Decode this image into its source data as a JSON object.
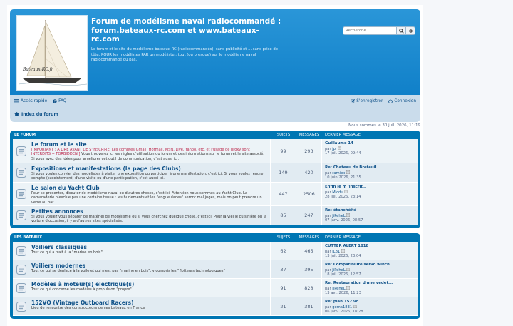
{
  "header": {
    "title": "Forum de modélisme naval radiocommandé : forum.bateaux-rc.com et www.bateaux-rc.com",
    "description": "Le forum et le site du modélisme bateaux RC (radiocommandés), sans publicité et ... sans prise de tête. POUR les modélistes PAR un modéliste : tout (ou presque) sur le modélisme naval radiocommandé ou pas.",
    "logo_text": "Bateaux-RC.fr",
    "search_placeholder": "Recherche…"
  },
  "nav": {
    "quick_access": "Accès rapide",
    "faq": "FAQ",
    "register": "S'enregistrer",
    "login": "Connexion",
    "breadcrumb": "Index du forum"
  },
  "datetime": "Nous sommes le 30 juil. 2026, 11:19",
  "columns": {
    "topics": "SUJETS",
    "messages": "MESSAGES",
    "last_post": "DERNIER MESSAGE"
  },
  "categories": [
    {
      "title": "LE FORUM",
      "forums": [
        {
          "name": "Le forum et le site",
          "warning": "[IMPORTANT : A LIRE AVANT DE S'INSCRIRE. Les comptes Gmail, Hotmail, MSN, Live, Yahoo, etc. et l'usage de proxy sont INTERDITS = FORBIDDEN ]",
          "desc": "Vous trouverez ici les règles d'utilisation du forum et des informations sur le forum et le site associé. Si vous avez des idées pour améliorer cet outil de communication, c'est aussi ici.",
          "topics": "99",
          "posts": "293",
          "last_title": "Guillaume 14",
          "last_by": "par",
          "last_author": "jpl",
          "last_date": "17 juil. 2026, 09:44"
        },
        {
          "name": "Expositions et manifestations (la page des Clubs)",
          "warning": "",
          "desc": "Si vous voulez convier des modélistes à visiter une exposition ou participer à une manifestation, c'est ici. Si vous voulez rendre compte (succintement) d'une visite ou d'une participation, c'est aussi ici.",
          "topics": "149",
          "posts": "420",
          "last_title": "Re: Chateau de Breteuil",
          "last_by": "par",
          "last_author": "ramiex",
          "last_date": "10 juin 2026, 21:35"
        },
        {
          "name": "Le salon du Yacht Club",
          "warning": "",
          "desc": "Pour se présenter, discuter de modélisme naval ou d'autres choses, c'est ici. Attention nous sommes au Yacht Club. La camaraderie n'exclue pas une certaine tenue : les hurlements et les \"engueulades\" seront mal jugés, mais on peut prendre un verre au bar.",
          "topics": "447",
          "posts": "2506",
          "last_title": "Enfin je m 'inscrit..",
          "last_by": "par",
          "last_author": "Micdu",
          "last_date": "28 juil. 2026, 23:14"
        },
        {
          "name": "Petites annonces",
          "warning": "",
          "desc": "Si vous voulez vous séparer de matériel de modélisme ou si vous cherchez quelque chose, c'est ici. Pour la vieille cuisinière ou la voiture d'occasion, il y a d'autres sites spécialisés.",
          "topics": "85",
          "posts": "247",
          "last_title": "Re: étanchéité",
          "last_by": "par",
          "last_author": "JiPeheL",
          "last_date": "07 janv. 2026, 08:57"
        }
      ]
    },
    {
      "title": "LES BATEAUX",
      "forums": [
        {
          "name": "Voiliers classiques",
          "warning": "",
          "desc": "Tout ce qui a trait à la \"marine en bois\".",
          "topics": "62",
          "posts": "465",
          "last_title": "CUTTER ALERT 1818",
          "last_by": "par",
          "last_author": "JL81",
          "last_date": "13 juil. 2026, 23:04"
        },
        {
          "name": "Voiliers modernes",
          "warning": "",
          "desc": "Tout ce qui se déplace à la voile et qui n'est pas \"marine en bois\", y compris les \"flotteurs technologiques\"",
          "topics": "37",
          "posts": "395",
          "last_title": "Re: Compatibilité servo winch...",
          "last_by": "par",
          "last_author": "JiPeheL",
          "last_date": "18 juil. 2026, 12:57"
        },
        {
          "name": "Modèles à moteur(s) électrique(s)",
          "warning": "",
          "desc": "Tout ce qui concerne les modèles à propulsion \"propre\".",
          "topics": "91",
          "posts": "828",
          "last_title": "Re: Restauration d'une vedet...",
          "last_by": "par",
          "last_author": "JiPeheL",
          "last_date": "13 avr. 2026, 11:23"
        },
        {
          "name": "152VO (Vintage Outboard Racers)",
          "warning": "",
          "desc": "Lieu de rencontre des constructeurs de ces bateaux en France",
          "topics": "21",
          "posts": "381",
          "last_title": "Re: plan 152 vo",
          "last_by": "par",
          "last_author": "gema1831",
          "last_date": "06 janv. 2026, 18:28"
        }
      ]
    }
  ],
  "colors": {
    "header_blue": "#1a8bd0",
    "block_blue": "#0076b3",
    "link": "#105289",
    "warning": "#bc2a4d"
  }
}
